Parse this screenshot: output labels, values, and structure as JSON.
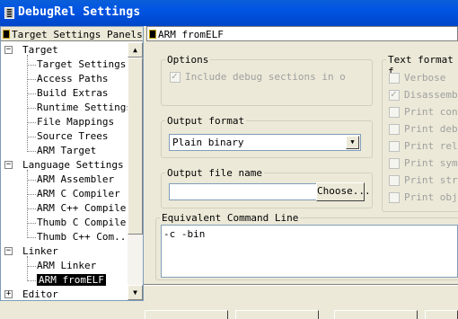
{
  "window": {
    "title": "DebugRel Settings"
  },
  "tree": {
    "header": "Target Settings Panels",
    "items": [
      {
        "label": "Target",
        "level": 0,
        "expander": "-"
      },
      {
        "label": "Target Settings",
        "level": 1
      },
      {
        "label": "Access Paths",
        "level": 1
      },
      {
        "label": "Build Extras",
        "level": 1
      },
      {
        "label": "Runtime Settings",
        "level": 1
      },
      {
        "label": "File Mappings",
        "level": 1
      },
      {
        "label": "Source Trees",
        "level": 1
      },
      {
        "label": "ARM Target",
        "level": 1
      },
      {
        "label": "Language Settings",
        "level": 0,
        "expander": "-"
      },
      {
        "label": "ARM Assembler",
        "level": 1
      },
      {
        "label": "ARM C Compiler",
        "level": 1
      },
      {
        "label": "ARM C++ Compiler",
        "level": 1
      },
      {
        "label": "Thumb C Compiler",
        "level": 1
      },
      {
        "label": "Thumb C++ Com...",
        "level": 1
      },
      {
        "label": "Linker",
        "level": 0,
        "expander": "-"
      },
      {
        "label": "ARM Linker",
        "level": 1
      },
      {
        "label": "ARM fromELF",
        "level": 1,
        "selected": true
      },
      {
        "label": "Editor",
        "level": 0,
        "expander": "+"
      }
    ]
  },
  "panel": {
    "title": "ARM fromELF",
    "options": {
      "label": "Options",
      "include_debug_label": "Include debug sections in o",
      "include_debug_checked": true
    },
    "output_format": {
      "label": "Output format",
      "value": "Plain binary"
    },
    "output_file": {
      "label": "Output file name",
      "value": "",
      "choose_button": "Choose..."
    },
    "text_format": {
      "label": "Text format f",
      "items": [
        {
          "label": "Verbose",
          "checked": false
        },
        {
          "label": "Disassembl",
          "checked": true
        },
        {
          "label": "Print cont",
          "checked": false
        },
        {
          "label": "Print debu",
          "checked": false
        },
        {
          "label": "Print relo",
          "checked": false
        },
        {
          "label": "Print symb",
          "checked": false
        },
        {
          "label": "Print stri",
          "checked": false
        },
        {
          "label": "Print obje",
          "checked": false
        }
      ]
    },
    "command_line": {
      "label": "Equivalent Command Line",
      "value": "-c -bin"
    }
  },
  "colors": {
    "titlebar": "#0054e3",
    "selection": "#000000",
    "face": "#ece9d8"
  }
}
